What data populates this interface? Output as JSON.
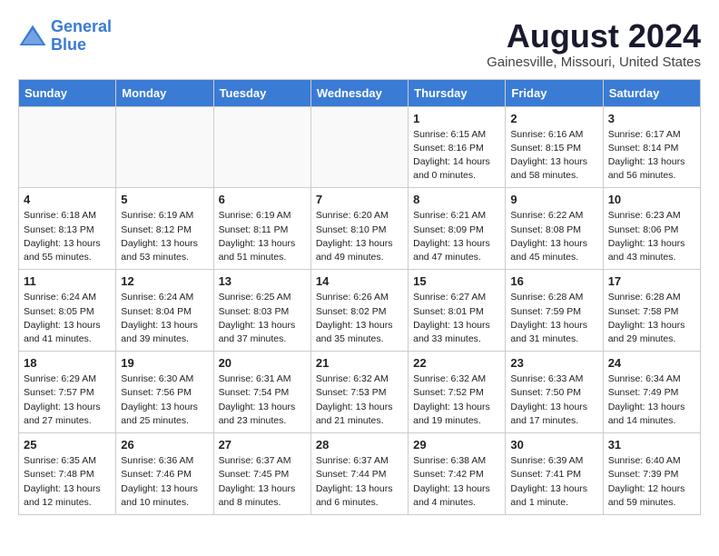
{
  "logo": {
    "line1": "General",
    "line2": "Blue"
  },
  "title": "August 2024",
  "location": "Gainesville, Missouri, United States",
  "weekdays": [
    "Sunday",
    "Monday",
    "Tuesday",
    "Wednesday",
    "Thursday",
    "Friday",
    "Saturday"
  ],
  "weeks": [
    [
      {
        "day": "",
        "info": ""
      },
      {
        "day": "",
        "info": ""
      },
      {
        "day": "",
        "info": ""
      },
      {
        "day": "",
        "info": ""
      },
      {
        "day": "1",
        "info": "Sunrise: 6:15 AM\nSunset: 8:16 PM\nDaylight: 14 hours\nand 0 minutes."
      },
      {
        "day": "2",
        "info": "Sunrise: 6:16 AM\nSunset: 8:15 PM\nDaylight: 13 hours\nand 58 minutes."
      },
      {
        "day": "3",
        "info": "Sunrise: 6:17 AM\nSunset: 8:14 PM\nDaylight: 13 hours\nand 56 minutes."
      }
    ],
    [
      {
        "day": "4",
        "info": "Sunrise: 6:18 AM\nSunset: 8:13 PM\nDaylight: 13 hours\nand 55 minutes."
      },
      {
        "day": "5",
        "info": "Sunrise: 6:19 AM\nSunset: 8:12 PM\nDaylight: 13 hours\nand 53 minutes."
      },
      {
        "day": "6",
        "info": "Sunrise: 6:19 AM\nSunset: 8:11 PM\nDaylight: 13 hours\nand 51 minutes."
      },
      {
        "day": "7",
        "info": "Sunrise: 6:20 AM\nSunset: 8:10 PM\nDaylight: 13 hours\nand 49 minutes."
      },
      {
        "day": "8",
        "info": "Sunrise: 6:21 AM\nSunset: 8:09 PM\nDaylight: 13 hours\nand 47 minutes."
      },
      {
        "day": "9",
        "info": "Sunrise: 6:22 AM\nSunset: 8:08 PM\nDaylight: 13 hours\nand 45 minutes."
      },
      {
        "day": "10",
        "info": "Sunrise: 6:23 AM\nSunset: 8:06 PM\nDaylight: 13 hours\nand 43 minutes."
      }
    ],
    [
      {
        "day": "11",
        "info": "Sunrise: 6:24 AM\nSunset: 8:05 PM\nDaylight: 13 hours\nand 41 minutes."
      },
      {
        "day": "12",
        "info": "Sunrise: 6:24 AM\nSunset: 8:04 PM\nDaylight: 13 hours\nand 39 minutes."
      },
      {
        "day": "13",
        "info": "Sunrise: 6:25 AM\nSunset: 8:03 PM\nDaylight: 13 hours\nand 37 minutes."
      },
      {
        "day": "14",
        "info": "Sunrise: 6:26 AM\nSunset: 8:02 PM\nDaylight: 13 hours\nand 35 minutes."
      },
      {
        "day": "15",
        "info": "Sunrise: 6:27 AM\nSunset: 8:01 PM\nDaylight: 13 hours\nand 33 minutes."
      },
      {
        "day": "16",
        "info": "Sunrise: 6:28 AM\nSunset: 7:59 PM\nDaylight: 13 hours\nand 31 minutes."
      },
      {
        "day": "17",
        "info": "Sunrise: 6:28 AM\nSunset: 7:58 PM\nDaylight: 13 hours\nand 29 minutes."
      }
    ],
    [
      {
        "day": "18",
        "info": "Sunrise: 6:29 AM\nSunset: 7:57 PM\nDaylight: 13 hours\nand 27 minutes."
      },
      {
        "day": "19",
        "info": "Sunrise: 6:30 AM\nSunset: 7:56 PM\nDaylight: 13 hours\nand 25 minutes."
      },
      {
        "day": "20",
        "info": "Sunrise: 6:31 AM\nSunset: 7:54 PM\nDaylight: 13 hours\nand 23 minutes."
      },
      {
        "day": "21",
        "info": "Sunrise: 6:32 AM\nSunset: 7:53 PM\nDaylight: 13 hours\nand 21 minutes."
      },
      {
        "day": "22",
        "info": "Sunrise: 6:32 AM\nSunset: 7:52 PM\nDaylight: 13 hours\nand 19 minutes."
      },
      {
        "day": "23",
        "info": "Sunrise: 6:33 AM\nSunset: 7:50 PM\nDaylight: 13 hours\nand 17 minutes."
      },
      {
        "day": "24",
        "info": "Sunrise: 6:34 AM\nSunset: 7:49 PM\nDaylight: 13 hours\nand 14 minutes."
      }
    ],
    [
      {
        "day": "25",
        "info": "Sunrise: 6:35 AM\nSunset: 7:48 PM\nDaylight: 13 hours\nand 12 minutes."
      },
      {
        "day": "26",
        "info": "Sunrise: 6:36 AM\nSunset: 7:46 PM\nDaylight: 13 hours\nand 10 minutes."
      },
      {
        "day": "27",
        "info": "Sunrise: 6:37 AM\nSunset: 7:45 PM\nDaylight: 13 hours\nand 8 minutes."
      },
      {
        "day": "28",
        "info": "Sunrise: 6:37 AM\nSunset: 7:44 PM\nDaylight: 13 hours\nand 6 minutes."
      },
      {
        "day": "29",
        "info": "Sunrise: 6:38 AM\nSunset: 7:42 PM\nDaylight: 13 hours\nand 4 minutes."
      },
      {
        "day": "30",
        "info": "Sunrise: 6:39 AM\nSunset: 7:41 PM\nDaylight: 13 hours\nand 1 minute."
      },
      {
        "day": "31",
        "info": "Sunrise: 6:40 AM\nSunset: 7:39 PM\nDaylight: 12 hours\nand 59 minutes."
      }
    ]
  ]
}
